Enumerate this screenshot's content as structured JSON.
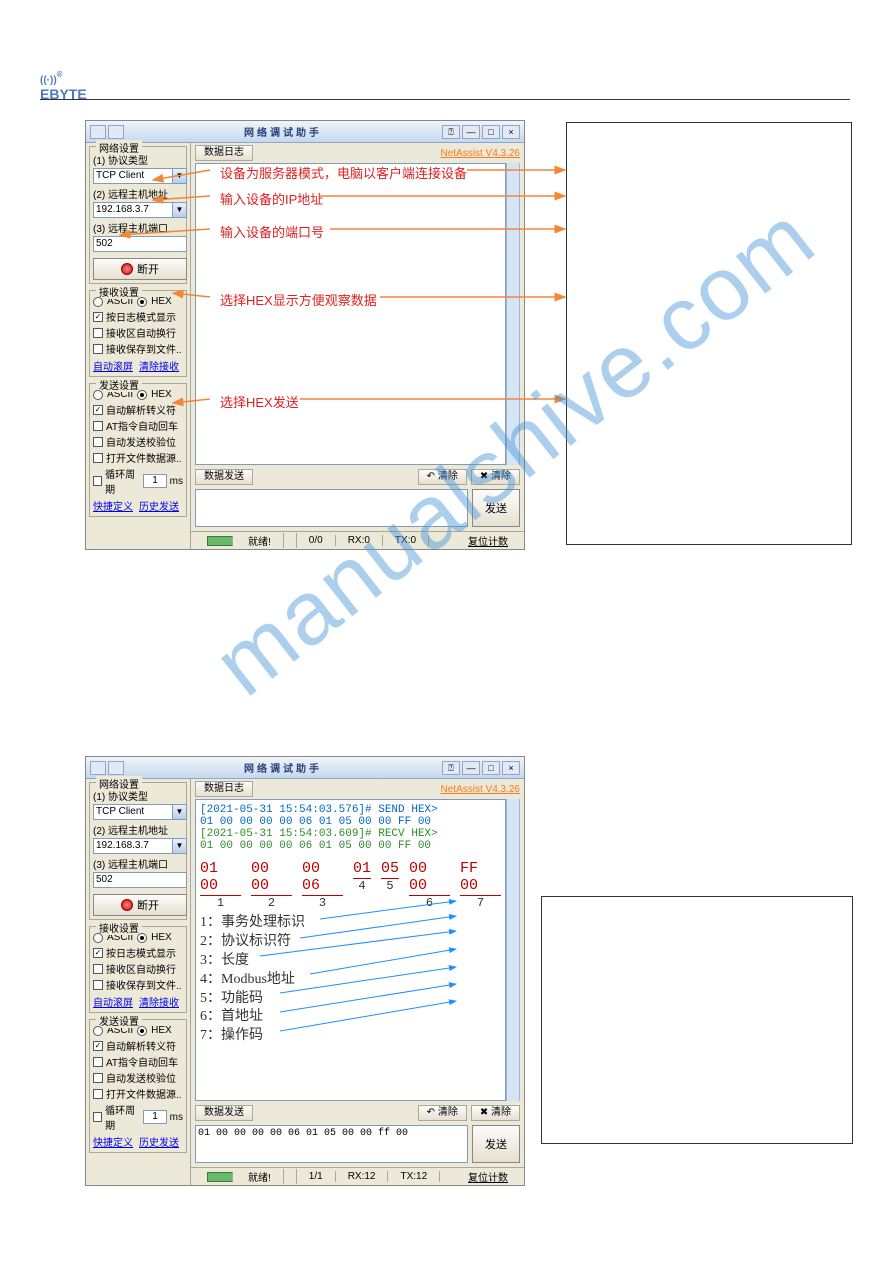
{
  "brand": {
    "name": "EBYTE",
    "reg": "®"
  },
  "watermark": "manualshive.com",
  "app1": {
    "title": "网络调试助手",
    "version": "NetAssist V4.3.26",
    "net": {
      "group": "网络设置",
      "proto_label": "(1) 协议类型",
      "proto_value": "TCP Client",
      "host_label": "(2) 远程主机地址",
      "host_value": "192.168.3.7",
      "port_label": "(3) 远程主机端口",
      "port_value": "502",
      "connect": "断开"
    },
    "recv": {
      "group": "接收设置",
      "ascii": "ASCII",
      "hex": "HEX",
      "opt1": "按日志模式显示",
      "opt2": "接收区自动换行",
      "opt3": "接收保存到文件..",
      "link1": "自动滚屏",
      "link2": "清除接收"
    },
    "send": {
      "group": "发送设置",
      "ascii": "ASCII",
      "hex": "HEX",
      "opt1": "自动解析转义符",
      "opt2": "AT指令自动回车",
      "opt3": "自动发送校验位",
      "opt4": "打开文件数据源..",
      "loop_label": "循环周期",
      "loop_val": "1",
      "loop_unit": "ms",
      "link1": "快捷定义",
      "link2": "历史发送"
    },
    "toolbar": {
      "log": "数据日志",
      "send": "数据发送",
      "clear1": "清除",
      "clear2": "清除"
    },
    "sendbtn": "发送",
    "status": {
      "ready": "就绪!",
      "count": "0/0",
      "rx": "RX:0",
      "tx": "TX:0",
      "reset": "复位计数"
    },
    "annots": {
      "a1": "设备为服务器模式，电脑以客户端连接设备",
      "a2": "输入设备的IP地址",
      "a3": "输入设备的端口号",
      "a4": "选择HEX显示方便观察数据",
      "a5": "选择HEX发送"
    }
  },
  "app2": {
    "title": "网络调试助手",
    "version": "NetAssist V4.3.26",
    "net": {
      "group": "网络设置",
      "proto_label": "(1) 协议类型",
      "proto_value": "TCP Client",
      "host_label": "(2) 远程主机地址",
      "host_value": "192.168.3.7",
      "port_label": "(3) 远程主机端口",
      "port_value": "502",
      "connect": "断开"
    },
    "recv": {
      "group": "接收设置",
      "ascii": "ASCII",
      "hex": "HEX",
      "opt1": "按日志模式显示",
      "opt2": "接收区自动换行",
      "opt3": "接收保存到文件..",
      "link1": "自动滚屏",
      "link2": "清除接收"
    },
    "send": {
      "group": "发送设置",
      "ascii": "ASCII",
      "hex": "HEX",
      "opt1": "自动解析转义符",
      "opt2": "AT指令自动回车",
      "opt3": "自动发送校验位",
      "opt4": "打开文件数据源..",
      "loop_label": "循环周期",
      "loop_val": "1",
      "loop_unit": "ms",
      "link1": "快捷定义",
      "link2": "历史发送"
    },
    "toolbar": {
      "log": "数据日志",
      "send": "数据发送",
      "clear1": "清除",
      "clear2": "清除"
    },
    "log": {
      "line1_ts": "[2021-05-31 15:54:03.576]# SEND HEX>",
      "line1_data": "01 00 00 00 00 06 01 05 00 00 FF 00",
      "line2_ts": "[2021-05-31 15:54:03.609]# RECV HEX>",
      "line2_data": "01 00 00 00 00 06 01 05 00 00 FF 00"
    },
    "hex": {
      "groups": [
        "01 00",
        "00 00",
        "00 06",
        "01",
        "05",
        "00 00",
        "FF 00"
      ],
      "idx": [
        "1",
        "2",
        "3",
        "4",
        "5",
        "6",
        "7"
      ]
    },
    "legend": {
      "l1": "1：事务处理标识",
      "l2": "2：协议标识符",
      "l3": "3：长度",
      "l4": "4：Modbus地址",
      "l5": "5：功能码",
      "l6": "6：首地址",
      "l7": "7：操作码"
    },
    "sendinput": "01 00 00 00 00 06 01 05 00 00 ff 00",
    "sendbtn": "发送",
    "status": {
      "ready": "就绪!",
      "count": "1/1",
      "rx": "RX:12",
      "tx": "TX:12",
      "reset": "复位计数"
    }
  }
}
